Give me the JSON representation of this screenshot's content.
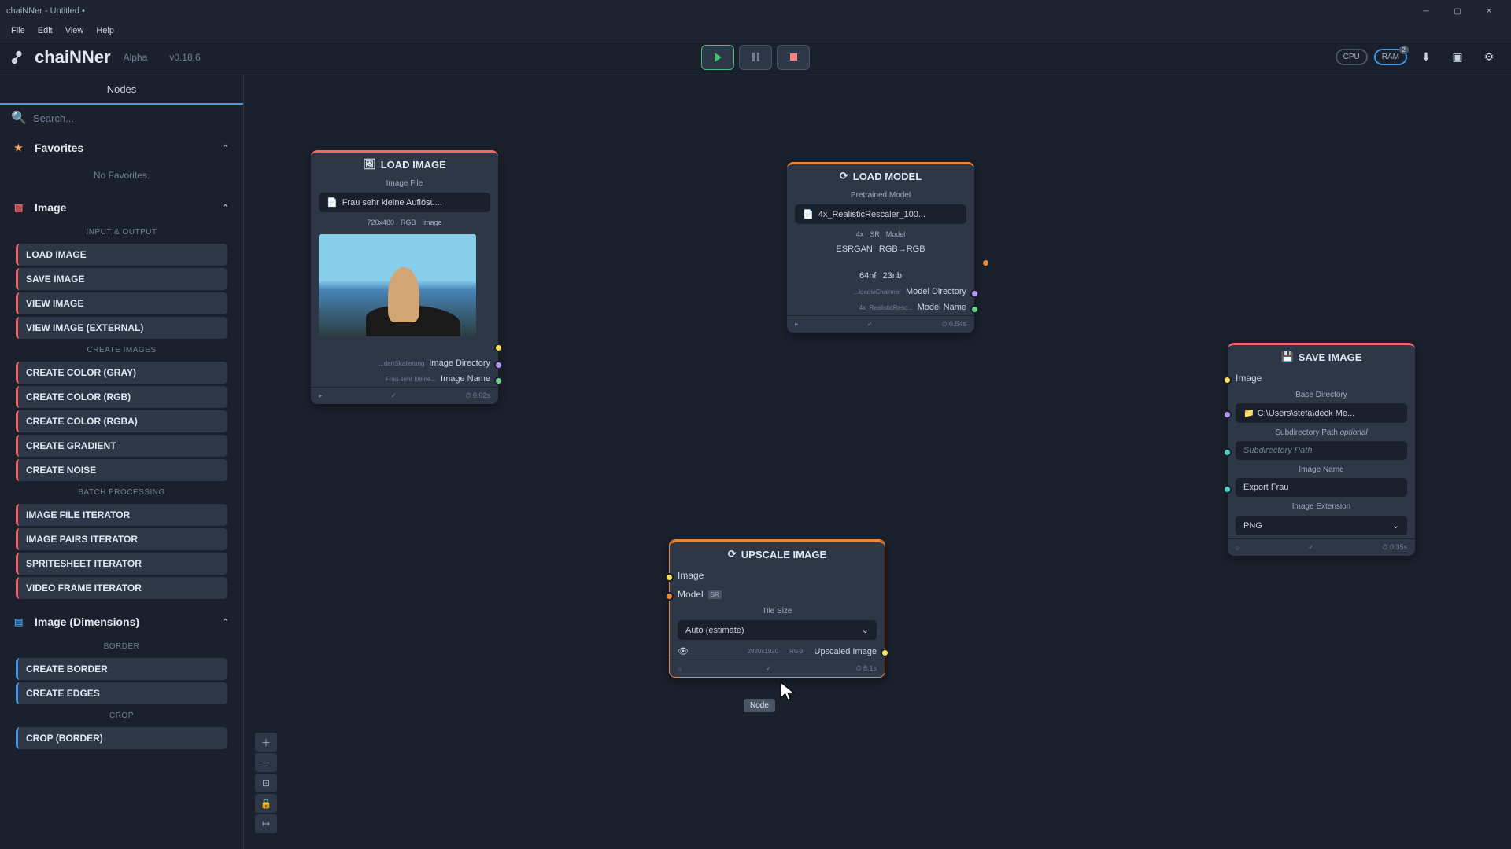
{
  "window": {
    "title": "chaiNNer - Untitled •"
  },
  "menu": {
    "file": "File",
    "edit": "Edit",
    "view": "View",
    "help": "Help"
  },
  "app": {
    "name": "chaiNNer",
    "alpha": "Alpha",
    "version": "v0.18.6"
  },
  "toolbar": {
    "cpu": "CPU",
    "ram": "RAM",
    "ram_badge": "2"
  },
  "sidebar": {
    "tab": "Nodes",
    "search_placeholder": "Search...",
    "favorites": {
      "title": "Favorites",
      "empty": "No Favorites."
    },
    "image": {
      "title": "Image",
      "sec_io": "INPUT & OUTPUT",
      "items_io": [
        "LOAD IMAGE",
        "SAVE IMAGE",
        "VIEW IMAGE",
        "VIEW IMAGE (EXTERNAL)"
      ],
      "sec_create": "CREATE IMAGES",
      "items_create": [
        "CREATE COLOR (GRAY)",
        "CREATE COLOR (RGB)",
        "CREATE COLOR (RGBA)",
        "CREATE GRADIENT",
        "CREATE NOISE"
      ],
      "sec_batch": "BATCH PROCESSING",
      "items_batch": [
        "IMAGE FILE ITERATOR",
        "IMAGE PAIRS ITERATOR",
        "SPRITESHEET ITERATOR",
        "VIDEO FRAME ITERATOR"
      ]
    },
    "dimensions": {
      "title": "Image (Dimensions)",
      "sec_border": "BORDER",
      "items_border": [
        "CREATE BORDER",
        "CREATE EDGES"
      ],
      "sec_crop": "CROP",
      "items_crop": [
        "CROP (BORDER)"
      ]
    }
  },
  "nodes": {
    "load_image": {
      "title": "LOAD IMAGE",
      "file_label": "Image File",
      "file_value": "Frau sehr kleine Auflösu...",
      "meta_dims": "720x480",
      "meta_mode": "RGB",
      "meta_type": "Image",
      "dir_small": "...der\\Skalierung",
      "dir_label": "Image Directory",
      "name_small": "Frau sehr kleine...",
      "name_label": "Image Name",
      "footer_time": "0.02s"
    },
    "load_model": {
      "title": "LOAD MODEL",
      "file_label": "Pretrained Model",
      "file_value": "4x_RealisticRescaler_100...",
      "meta_scale": "4x",
      "meta_sr": "SR",
      "meta_type": "Model",
      "arch": "ESRGAN",
      "colorspace": "RGB→RGB",
      "param1": "64nf",
      "param2": "23nb",
      "dir_small": "...loads\\Chainner",
      "dir_label": "Model Directory",
      "name_small": "4x_RealisticResc...",
      "name_label": "Model Name",
      "footer_time": "0.54s"
    },
    "upscale": {
      "title": "UPSCALE IMAGE",
      "in_image": "Image",
      "in_model": "Model",
      "sr_tag": "SR",
      "tile_label": "Tile Size",
      "tile_value": "Auto (estimate)",
      "out_dims": "2880x1920",
      "out_mode": "RGB",
      "out_label": "Upscaled Image",
      "footer_time": "6.1s"
    },
    "save_image": {
      "title": "SAVE IMAGE",
      "in_image": "Image",
      "dir_label": "Base Directory",
      "dir_value": "C:\\Users\\stefa\\deck Me...",
      "sub_label": "Subdirectory Path",
      "sub_optional": "optional",
      "sub_placeholder": "Subdirectory Path",
      "name_label": "Image Name",
      "name_value": "Export Frau",
      "ext_label": "Image Extension",
      "ext_value": "PNG",
      "footer_time": "0.35s"
    }
  },
  "tooltip": "Node"
}
